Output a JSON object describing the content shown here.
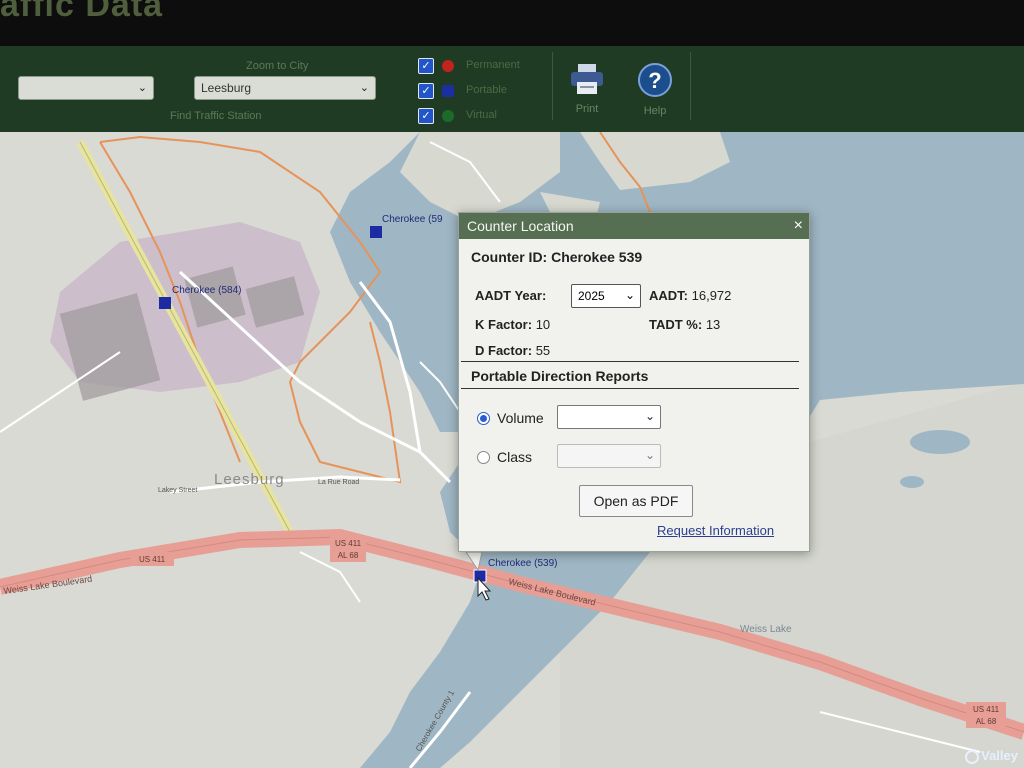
{
  "app": {
    "title": "affic Data"
  },
  "toolbar": {
    "county_select": {
      "value": ""
    },
    "zoom_to_city_label": "Zoom to City",
    "city_select": {
      "value": "Leesburg"
    },
    "find_station_label": "Find Traffic Station",
    "legend": [
      {
        "label": "Permanent",
        "color": "#c0241c",
        "checked": true
      },
      {
        "label": "Portable",
        "color": "#1c2fa0",
        "checked": true
      },
      {
        "label": "Virtual",
        "color": "#1e6a2c",
        "checked": true
      }
    ],
    "print_label": "Print",
    "help_label": "Help"
  },
  "map": {
    "city_label": "Leesburg",
    "labels": {
      "cherokee_584": "Cherokee (584)",
      "cherokee_59": "Cherokee (59",
      "cherokee_539": "Cherokee (539)",
      "us411_a": "US 411",
      "al68_a": "AL 68",
      "us411_b": "US 411",
      "us411_c": "US 411",
      "al68_c": "AL 68",
      "weiss_blvd_a": "Weiss Lake Boulevard",
      "weiss_blvd_b": "Weiss Lake Boulevard",
      "weiss_lake": "Weiss Lake",
      "la_rue_road": "La Rue Road",
      "lakey_street": "Lakey Street",
      "cherokee_county_rd": "Cherokee County 1"
    }
  },
  "popup": {
    "title": "Counter Location",
    "close": "×",
    "counter_id_label": "Counter ID:",
    "counter_id_value": "Cherokee 539",
    "aadt_year_label": "AADT Year:",
    "aadt_year_value": "2025",
    "aadt_label": "AADT:",
    "aadt_value": "16,972",
    "k_factor_label": "K Factor:",
    "k_factor_value": "10",
    "tadt_label": "TADT %:",
    "tadt_value": "13",
    "d_factor_label": "D Factor:",
    "d_factor_value": "55",
    "reports_heading": "Portable Direction Reports",
    "volume_label": "Volume",
    "class_label": "Class",
    "pdf_button": "Open as PDF",
    "request_link": "Request Information"
  },
  "watermark": "Valley"
}
